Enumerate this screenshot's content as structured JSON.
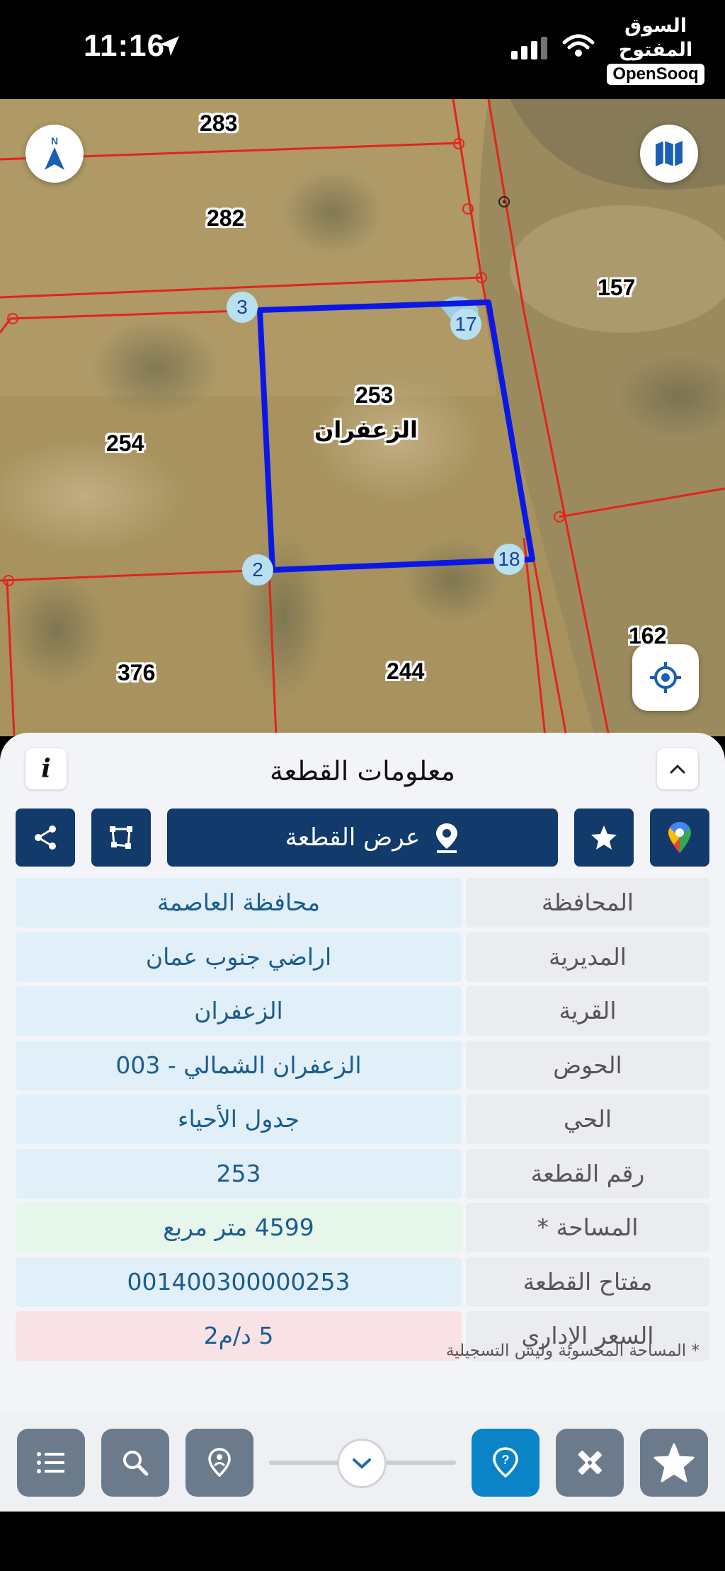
{
  "status_bar": {
    "time": "11:16",
    "brand_ar": "السوق المفتوح",
    "brand_en": "OpenSooq"
  },
  "map": {
    "parcels": {
      "p283": "283",
      "p282": "282",
      "p157": "157",
      "p253": "253",
      "p254": "254",
      "p162": "162",
      "p376": "376",
      "p244": "244"
    },
    "selected_parcel_name": "الزعفران",
    "vertices": {
      "v3": "3",
      "v17": "17",
      "v2": "2",
      "v18": "18"
    },
    "icons": {
      "north": "north-arrow-icon",
      "layers": "map-layers-icon",
      "locate": "my-location-icon"
    },
    "colors": {
      "parcel_boundary": "#e3241b",
      "selected_boundary": "#0a18e6",
      "vertex_badge": "#b9e0f0"
    }
  },
  "sheet": {
    "title": "معلومات القطعة",
    "info_icon": "i",
    "show_parcel_label": "عرض القطعة",
    "rows": [
      {
        "label": "المحافظة",
        "value": "محافظة العاصمة",
        "tone": "blue"
      },
      {
        "label": "المديرية",
        "value": "اراضي جنوب عمان",
        "tone": "blue"
      },
      {
        "label": "القرية",
        "value": "الزعفران",
        "tone": "blue"
      },
      {
        "label": "الحوض",
        "value": "الزعفران الشمالي - 003",
        "tone": "blue"
      },
      {
        "label": "الحي",
        "value": "جدول الأحياء",
        "tone": "blue"
      },
      {
        "label": "رقم القطعة",
        "value": "253",
        "tone": "blue"
      },
      {
        "label": "المساحة *",
        "value": "4599   متر مربع",
        "tone": "green"
      },
      {
        "label": "مفتاح القطعة",
        "value": "001400300000253",
        "tone": "blue"
      },
      {
        "label": "السعر الإداري",
        "value": "5 د/م2",
        "tone": "red"
      }
    ],
    "footnote": "* المساحة المحسوبة وليس التسجيلية",
    "colors": {
      "action_button": "#123a6b",
      "value_blue": "#e0eff8",
      "value_green": "#e6f6ea",
      "value_red": "#f8e2e5"
    }
  },
  "toolbar": {
    "icons": [
      "list-icon",
      "search-icon",
      "location-pin-icon",
      "zoom-slider",
      "help-pin-icon",
      "measure-tools-icon",
      "star-icon"
    ],
    "active_color": "#0a84c6",
    "inactive_color": "#6c7b8c"
  }
}
